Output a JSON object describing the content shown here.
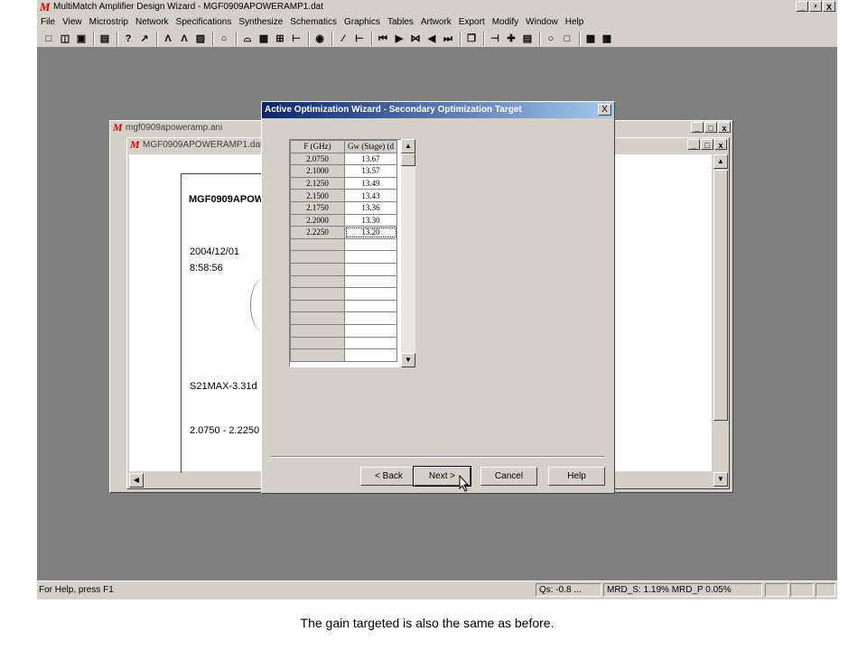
{
  "app": {
    "title": "MultiMatch Amplifier Design Wizard - MGF0909APOWERAMP1.dat",
    "logo": "M",
    "window_buttons": [
      "_",
      "²",
      "X"
    ],
    "menu": [
      "File",
      "View",
      "Microstrip",
      "Network",
      "Specifications",
      "Synthesize",
      "Schematics",
      "Graphics",
      "Tables",
      "Artwork",
      "Export",
      "Modify",
      "Window",
      "Help"
    ]
  },
  "mdi_outer": {
    "title": "mgf0909apoweramp.ani",
    "logo": "M"
  },
  "mdi_inner": {
    "title": "MGF0909APOWERAMP1.dat",
    "logo": "M"
  },
  "document": {
    "heading": "MGF0909APOW",
    "date": "2004/12/01",
    "time": "8:58:56",
    "s21": "S21MAX-3.31d",
    "range": "2.0750 - 2.2250"
  },
  "dialog": {
    "title": "Active Optimization Wizard - Secondary Optimization Target",
    "close": "X",
    "table": {
      "headers": [
        "F (GHz)",
        "Gw (Stage) (d"
      ],
      "rows": [
        [
          "2.0750",
          "13.67"
        ],
        [
          "2.1000",
          "13.57"
        ],
        [
          "2.1250",
          "13.49"
        ],
        [
          "2.1500",
          "13.43"
        ],
        [
          "2.1750",
          "13.36"
        ],
        [
          "2.2000",
          "13.30"
        ],
        [
          "2.2250",
          "13.20"
        ],
        [
          "",
          ""
        ],
        [
          "",
          ""
        ],
        [
          "",
          ""
        ],
        [
          "",
          ""
        ],
        [
          "",
          ""
        ],
        [
          "",
          ""
        ],
        [
          "",
          ""
        ],
        [
          "",
          ""
        ],
        [
          "",
          ""
        ],
        [
          "",
          ""
        ]
      ]
    },
    "buttons": {
      "back": "< Back",
      "next": "Next >",
      "cancel": "Cancel",
      "help": "Help"
    }
  },
  "status": {
    "help": "For Help, press F1",
    "qs": "Qs:  -0.8 ...",
    "mrd": "MRD_S:  1.19% MRD_P  0.05%"
  },
  "caption": "The gain targeted is also the same as before."
}
